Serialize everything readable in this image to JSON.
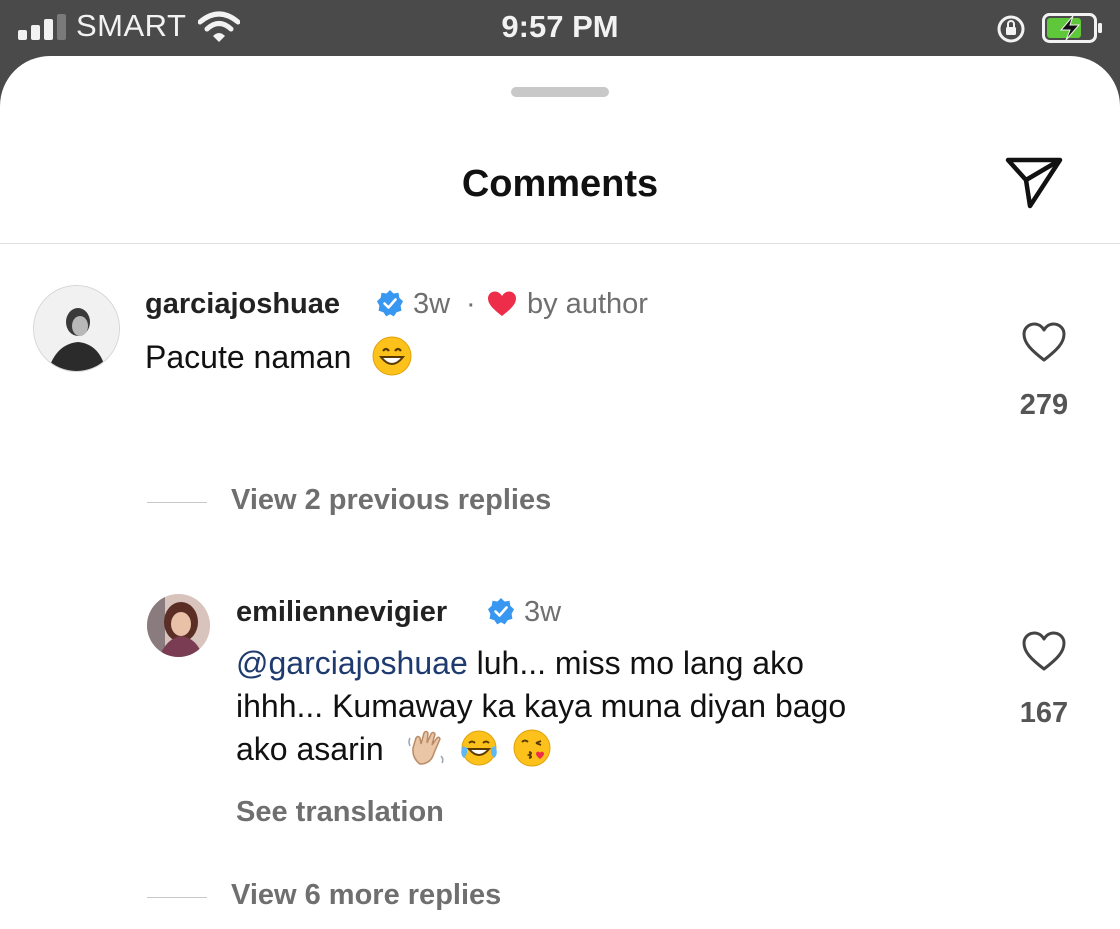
{
  "status_bar": {
    "carrier": "SMART",
    "time": "9:57 PM",
    "icons": [
      "cellular-signal-icon",
      "wifi-icon",
      "rotation-lock-icon",
      "battery-charging-icon"
    ]
  },
  "sheet": {
    "title": "Comments",
    "icons": [
      "send-icon"
    ]
  },
  "comments": [
    {
      "username": "garciajoshuae",
      "verified": true,
      "age": "3w",
      "separator": "·",
      "liked_by_author": "by author",
      "text": "Pacute naman",
      "emojis": [
        "grinning-face"
      ],
      "like_count": "279",
      "replies_link": "View 2 previous replies"
    },
    {
      "username": "emiliennevigier",
      "verified": true,
      "age": "3w",
      "mention": "@garciajoshuae",
      "text_line1_rest": "luh... miss mo lang ako",
      "text_line2": "ihhh... Kumaway ka kaya muna diyan bago",
      "text_line3": "ako asarin",
      "emojis": [
        "waving-hand",
        "face-with-tears-of-joy",
        "face-blowing-a-kiss"
      ],
      "like_count": "167",
      "translation_link": "See translation",
      "more_replies_link": "View 6 more replies"
    }
  ],
  "colors": {
    "status_bar_bg": "#4a4a4a",
    "sheet_bg": "#ffffff",
    "verified_blue": "#3897f0",
    "author_heart_red": "#ed2d49",
    "mention_blue": "#1e3a6e",
    "muted_text": "#6f6f6f"
  }
}
